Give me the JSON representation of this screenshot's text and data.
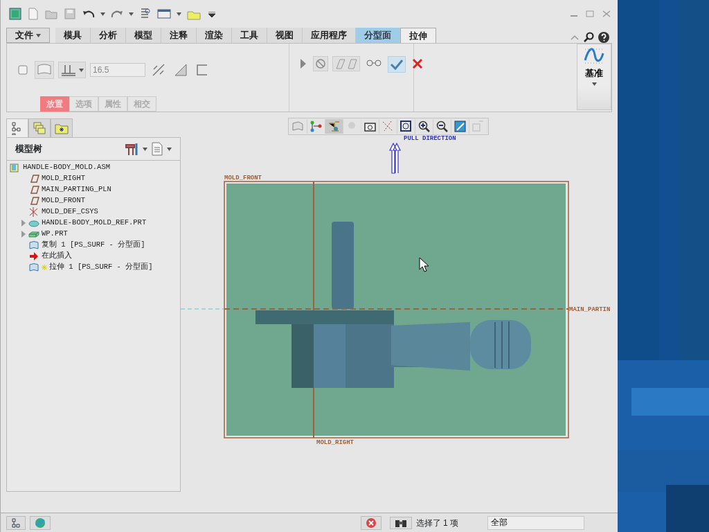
{
  "ribbon_tabs": [
    {
      "label": "文件",
      "kind": "file",
      "selected": false
    },
    {
      "label": "模具",
      "kind": "normal",
      "selected": false
    },
    {
      "label": "分析",
      "kind": "normal",
      "selected": false
    },
    {
      "label": "模型",
      "kind": "normal",
      "selected": false
    },
    {
      "label": "注释",
      "kind": "normal",
      "selected": false
    },
    {
      "label": "渲染",
      "kind": "normal",
      "selected": false
    },
    {
      "label": "工具",
      "kind": "normal",
      "selected": false
    },
    {
      "label": "视图",
      "kind": "normal",
      "selected": false
    },
    {
      "label": "应用程序",
      "kind": "normal",
      "selected": false
    },
    {
      "label": "分型面",
      "kind": "context",
      "selected": false
    },
    {
      "label": "拉伸",
      "kind": "normal",
      "selected": true
    }
  ],
  "depth_field": {
    "value": "16.5"
  },
  "sub_tabs": [
    {
      "label": "放置",
      "selected": true
    },
    {
      "label": "选项",
      "selected": false
    },
    {
      "label": "属性",
      "selected": false
    },
    {
      "label": "相交",
      "selected": false
    }
  ],
  "datum_button": {
    "label": "基准"
  },
  "panel_tabs": [
    {
      "selected": true
    },
    {
      "selected": false
    },
    {
      "selected": false
    }
  ],
  "model_tree": {
    "title": "模型树",
    "items": [
      {
        "label": "HANDLE-BODY_MOLD.ASM",
        "kind": "assembly",
        "children": [
          {
            "label": "MOLD_RIGHT",
            "kind": "plane"
          },
          {
            "label": "MAIN_PARTING_PLN",
            "kind": "plane"
          },
          {
            "label": "MOLD_FRONT",
            "kind": "plane"
          },
          {
            "label": "MOLD_DEF_CSYS",
            "kind": "csys"
          },
          {
            "label": "HANDLE-BODY_MOLD_REF.PRT",
            "kind": "refpart",
            "expanded": false
          },
          {
            "label": "WP.PRT",
            "kind": "workpiece",
            "expanded": false
          },
          {
            "label": "复制 1 [PS_SURF - 分型面]",
            "kind": "surface"
          },
          {
            "label": "在此插入",
            "kind": "insert"
          },
          {
            "label": "拉伸 1 [PS_SURF - 分型面]",
            "kind": "newsurface"
          }
        ]
      }
    ]
  },
  "view_toolbar": [
    {
      "selected": false,
      "disabled": false
    },
    {
      "selected": false,
      "disabled": false
    },
    {
      "selected": true,
      "disabled": false
    },
    {
      "disabled": true
    },
    {
      "selected": false,
      "disabled": false
    },
    {
      "selected": false,
      "disabled": false
    },
    {
      "selected": false,
      "disabled": false
    },
    {
      "selected": false,
      "disabled": false
    },
    {
      "selected": false,
      "disabled": false
    },
    {
      "selected": false,
      "disabled": false
    },
    {
      "disabled": true
    }
  ],
  "graphics": {
    "pull_direction": "PULL DIRECTION",
    "datum_labels": [
      {
        "label": "MOLD_FRONT",
        "kind": "top"
      },
      {
        "label": "MAIN_PARTIN",
        "kind": "right"
      },
      {
        "label": "MOLD_RIGHT",
        "kind": "bottom"
      }
    ]
  },
  "status_bar": {
    "message": "选择了 1 项",
    "filter": "全部"
  }
}
